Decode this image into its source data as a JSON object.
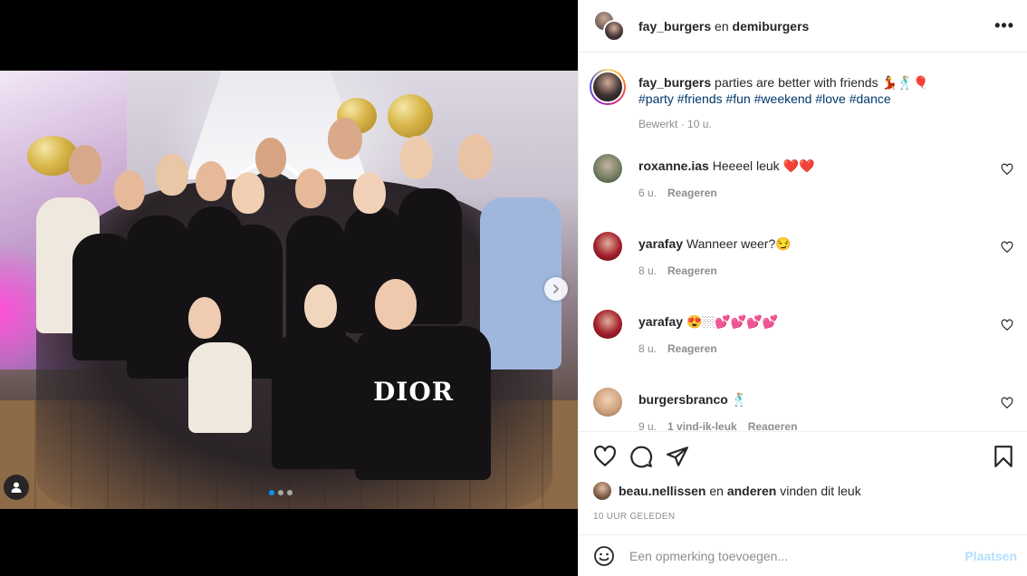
{
  "header": {
    "user1": "fay_burgers",
    "joiner": "en",
    "user2": "demiburgers",
    "more_icon": "more-horizontal-icon"
  },
  "caption": {
    "username": "fay_burgers",
    "text": "parties are better with friends 💃🕺🏼🎈",
    "hashtags": "#party #friends #fun #weekend #love #dance",
    "edited": "Bewerkt",
    "time": "10 u."
  },
  "comments": [
    {
      "username": "roxanne.ias",
      "text": "Heeeel leuk ❤️❤️",
      "time": "6 u.",
      "reply": "Reageren",
      "avatar_color": "#6e7a5e"
    },
    {
      "username": "yarafay",
      "text": "Wanneer weer?😏",
      "time": "8 u.",
      "reply": "Reageren",
      "avatar_color": "#a3202c"
    },
    {
      "username": "yarafay",
      "text": "😍🏼💕💕💕💕",
      "time": "8 u.",
      "reply": "Reageren",
      "avatar_color": "#a3202c"
    },
    {
      "username": "burgersbranco",
      "text": "🕺🏼",
      "time": "9 u.",
      "likes": "1 vind-ik-leuk",
      "reply": "Reageren",
      "avatar_color": "#cfa37f"
    }
  ],
  "likes": {
    "user": "beau.nellissen",
    "joiner": "en",
    "others": "anderen",
    "suffix": "vinden dit leuk"
  },
  "timestamp": "10 UUR GELEDEN",
  "add_comment": {
    "placeholder": "Een opmerking toevoegen...",
    "post_label": "Plaatsen"
  },
  "carousel": {
    "count": 3,
    "active": 0
  },
  "colors": {
    "accent": "#0095f6",
    "post_disabled": "#b2dffc",
    "hashtag": "#00376b",
    "muted": "#8e8e8e"
  }
}
